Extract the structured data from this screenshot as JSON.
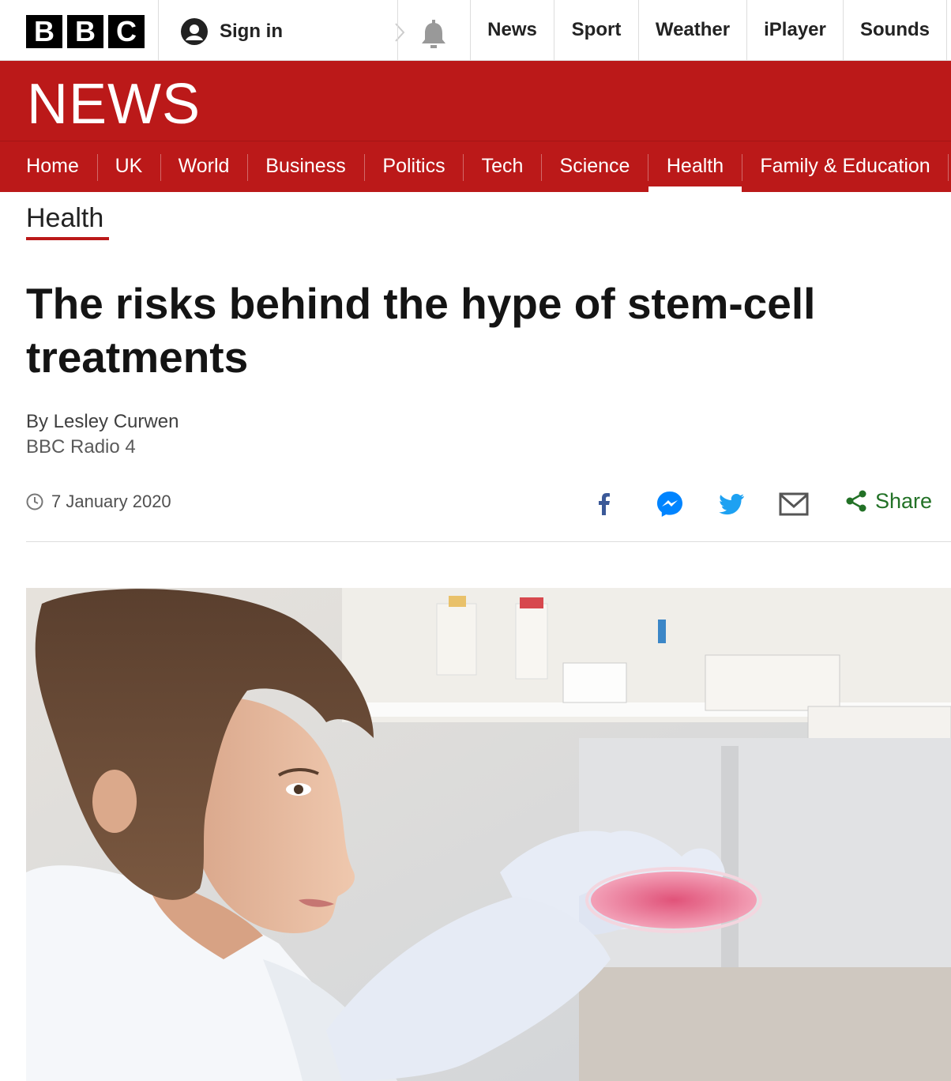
{
  "brand": {
    "letters": [
      "B",
      "B",
      "C"
    ]
  },
  "topbar": {
    "sign_in": "Sign in",
    "nav": [
      "News",
      "Sport",
      "Weather",
      "iPlayer",
      "Sounds"
    ]
  },
  "banner": {
    "title": "NEWS"
  },
  "section_nav": {
    "items": [
      "Home",
      "UK",
      "World",
      "Business",
      "Politics",
      "Tech",
      "Science",
      "Health",
      "Family & Education"
    ],
    "active": "Health"
  },
  "article": {
    "section": "Health",
    "headline": "The risks behind the hype of stem-cell treatments",
    "author": "By Lesley Curwen",
    "author_role": "BBC Radio 4",
    "date": "7 January 2020",
    "share_label": "Share"
  },
  "colors": {
    "brand_red": "#bb1919",
    "share_green": "#227126",
    "facebook_blue": "#3b5998",
    "messenger_blue": "#0084ff",
    "twitter_blue": "#1da1f2"
  },
  "icons": [
    "user-icon",
    "chevron-left-icon",
    "bell-icon",
    "clock-icon",
    "facebook-icon",
    "messenger-icon",
    "twitter-icon",
    "email-icon",
    "share-icon"
  ]
}
